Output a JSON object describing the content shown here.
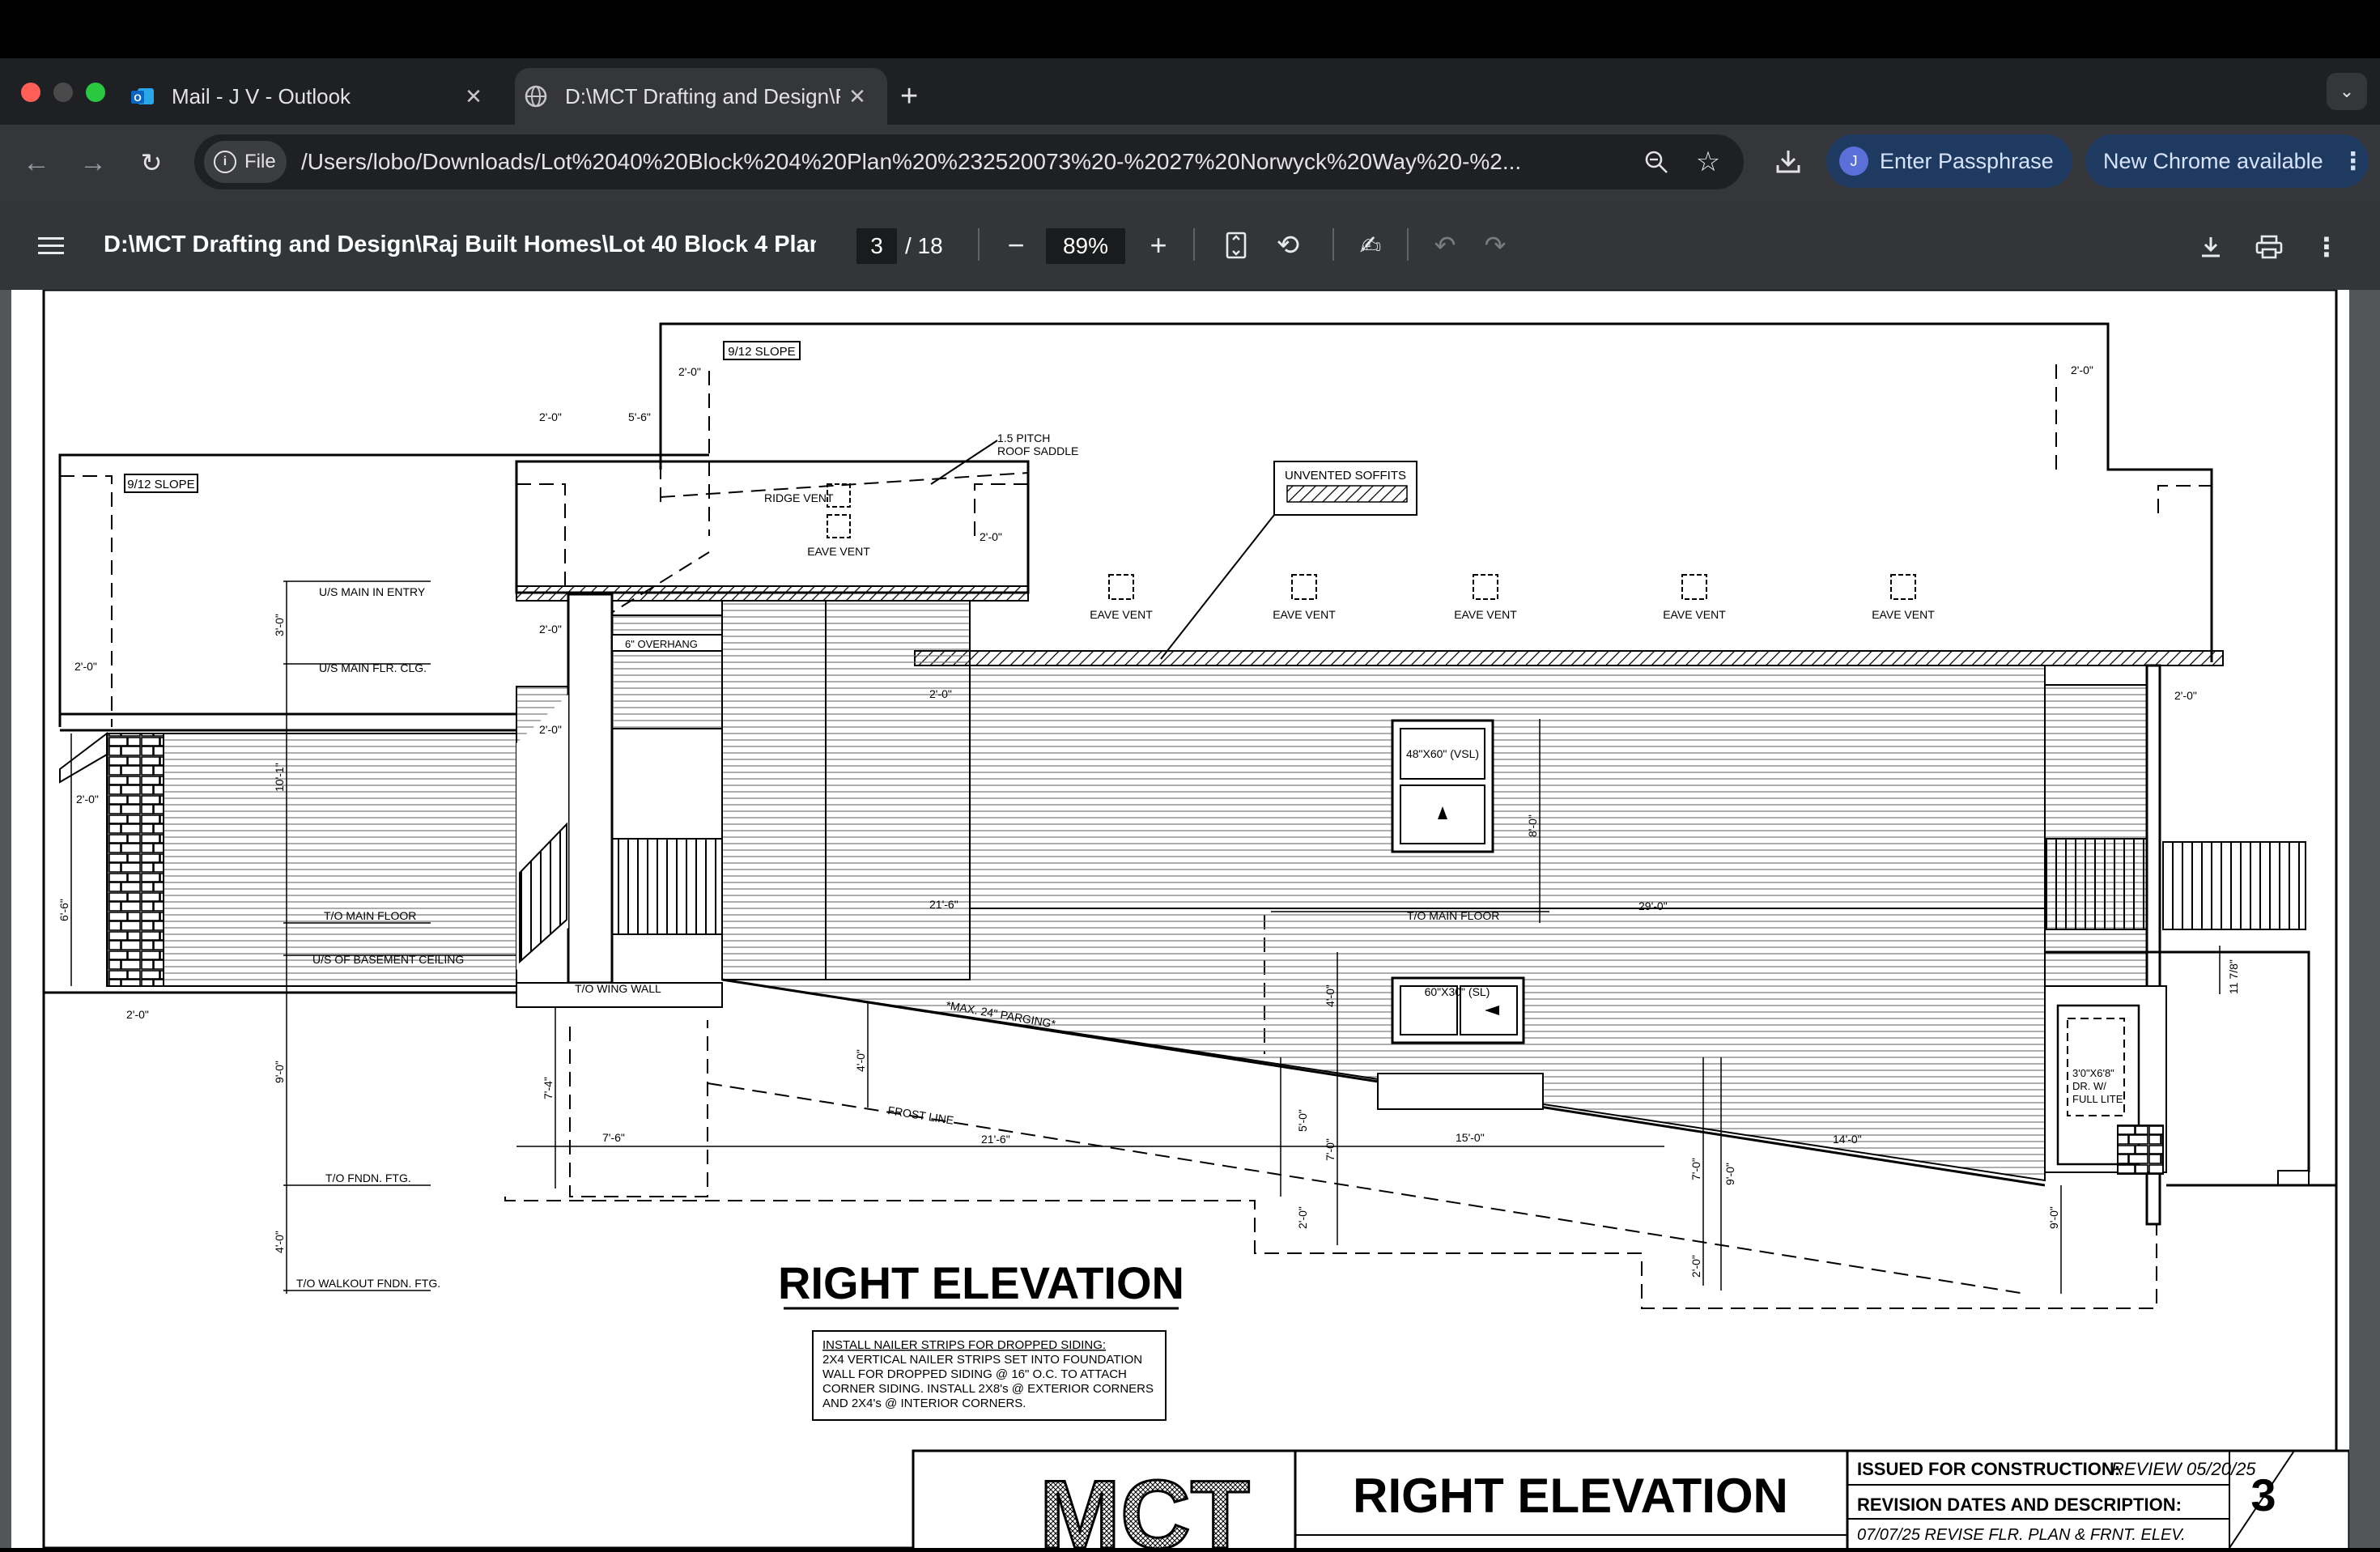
{
  "browser": {
    "tabs": [
      {
        "title": "Mail - J V - Outlook",
        "icon": "outlook-icon"
      },
      {
        "title": "D:\\MCT Drafting and Design\\R",
        "icon": "globe-icon"
      }
    ],
    "new_tab": "+",
    "url_chip": "File",
    "url": "/Users/lobo/Downloads/Lot%2040%20Block%204%20Plan%20%232520073%20-%2027%20Norwyck%20Way%20-%2...",
    "profile_pill": "Enter Passphrase",
    "profile_initial": "J",
    "update_pill": "New Chrome available"
  },
  "pdf_toolbar": {
    "title": "D:\\MCT Drafting and Design\\Raj Built Homes\\Lot 40 Block 4 Plan ...",
    "page_current": "3",
    "page_total": "/ 18",
    "zoom": "89%"
  },
  "drawing": {
    "title": "RIGHT ELEVATION",
    "note": [
      "INSTALL NAILER STRIPS FOR DROPPED SIDING:",
      "2X4 VERTICAL NAILER STRIPS SET INTO FOUNDATION",
      "WALL FOR DROPPED SIDING @ 16\" O.C.  TO ATTACH",
      "CORNER SIDING. INSTALL 2X8's @ EXTERIOR CORNERS",
      "AND 2X4's @ INTERIOR CORNERS."
    ],
    "labels": {
      "slope_left": "9/12 SLOPE",
      "slope_top": "9/12 SLOPE",
      "pitch": "1.5 PITCH",
      "saddle": "ROOF SADDLE",
      "ridge_vent": "RIDGE VENT",
      "eave_vent": "EAVE VENT",
      "unvented": "UNVENTED SOFFITS",
      "overhang": "6\" OVERHANG",
      "us_entry": "U/S MAIN IN ENTRY",
      "us_clg": "U/S MAIN FLR. CLG.",
      "to_main_floor": "T/O MAIN FLOOR",
      "us_basement": "U/S OF BASEMENT CEILING",
      "to_wing_wall": "T/O WING WALL",
      "parging": "*MAX. 24\" PARGING*",
      "frost_line": "FROST LINE",
      "to_fndn": "T/O FNDN. FTG.",
      "to_walkout": "T/O WALKOUT FNDN. FTG.",
      "window1": "48\"X60\" (VSL)",
      "window2": "60\"X30\" (SL)",
      "door": [
        "3'0\"X6'8\"",
        "DR. W/",
        "FULL LITE"
      ]
    },
    "dims": {
      "d2_0": "2'-0\"",
      "d5_6": "5'-6\"",
      "d6_6": "6'-6\"",
      "d3_0": "3'-0\"",
      "d10": "10'-1\"",
      "d9_0": "9'-0\"",
      "d4_0": "4'-0\"",
      "d7_4": "7'-4\"",
      "d7_6": "7'-6\"",
      "d21_6": "21'-6\"",
      "d15": "15'-0\"",
      "d14": "14'-0\"",
      "d29": "29'-0\"",
      "d8_0": "8'-0\"",
      "d5_0": "5'-0\"",
      "d7_0": "7'-0\"",
      "d11": "11 7/8\""
    },
    "title_block": {
      "heading": "RIGHT ELEVATION",
      "logo": "MCT",
      "issued_label": "ISSUED FOR CONSTRUCTION:",
      "issued_value": "REVIEW 05/20/25",
      "rev_label": "REVISION DATES AND DESCRIPTION:",
      "rev_value": "07/07/25 REVISE FLR. PLAN & FRNT. ELEV.",
      "sheet": "3"
    }
  }
}
